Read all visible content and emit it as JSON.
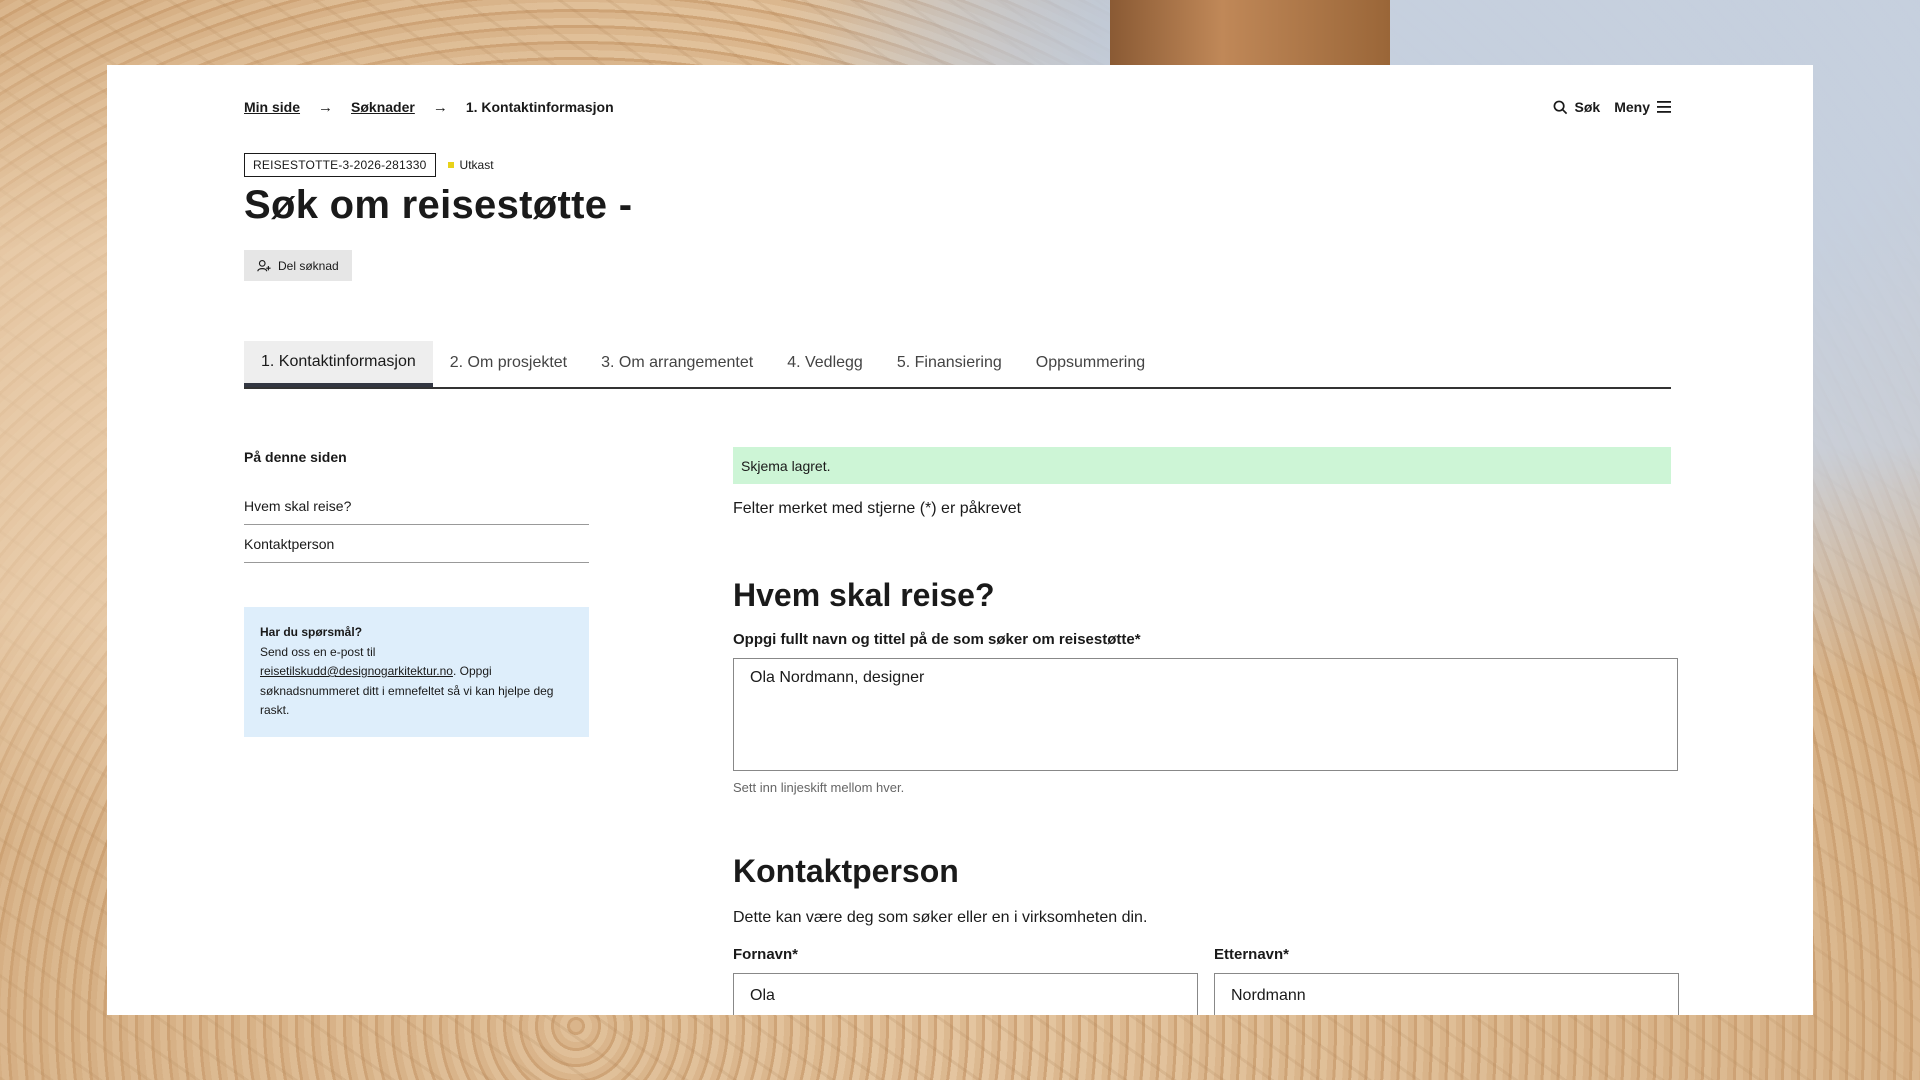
{
  "breadcrumb": {
    "items": [
      "Min side",
      "Søknader"
    ],
    "current": "1. Kontaktinformasjon"
  },
  "top_actions": {
    "search": "Søk",
    "menu": "Meny"
  },
  "application": {
    "id": "REISESTOTTE-3-2026-281330",
    "status": "Utkast",
    "status_color": "#e8d21a"
  },
  "title": "Søk om reisestøtte -",
  "share_button": "Del søknad",
  "tabs": [
    {
      "label": "1. Kontaktinformasjon"
    },
    {
      "label": "2. Om prosjektet"
    },
    {
      "label": "3. Om arrangementet"
    },
    {
      "label": "4. Vedlegg"
    },
    {
      "label": "5. Finansiering"
    },
    {
      "label": "Oppsummering"
    }
  ],
  "on_page": {
    "title": "På denne siden",
    "items": [
      "Hvem skal reise?",
      "Kontaktperson"
    ]
  },
  "help": {
    "heading": "Har du spørsmål?",
    "text_before": "Send oss en e-post til ",
    "email": "reisetilskudd@designogarkitektur.no",
    "text_after": ". Oppgi søknadsnummeret ditt i emnefeltet så vi kan hjelpe deg raskt."
  },
  "saved_message": "Skjema lagret.",
  "required_note": "Felter merket med stjerne (*) er påkrevet",
  "section1": {
    "heading": "Hvem skal reise?",
    "label": "Oppgi fullt navn og tittel på de som søker om reisestøtte*",
    "value": "Ola Nordmann, designer",
    "hint": "Sett inn linjeskift mellom hver."
  },
  "section2": {
    "heading": "Kontaktperson",
    "description": "Dette kan være deg som søker eller en i virksomheten din.",
    "first_name_label": "Fornavn*",
    "first_name_value": "Ola",
    "last_name_label": "Etternavn*",
    "last_name_value": "Nordmann"
  }
}
